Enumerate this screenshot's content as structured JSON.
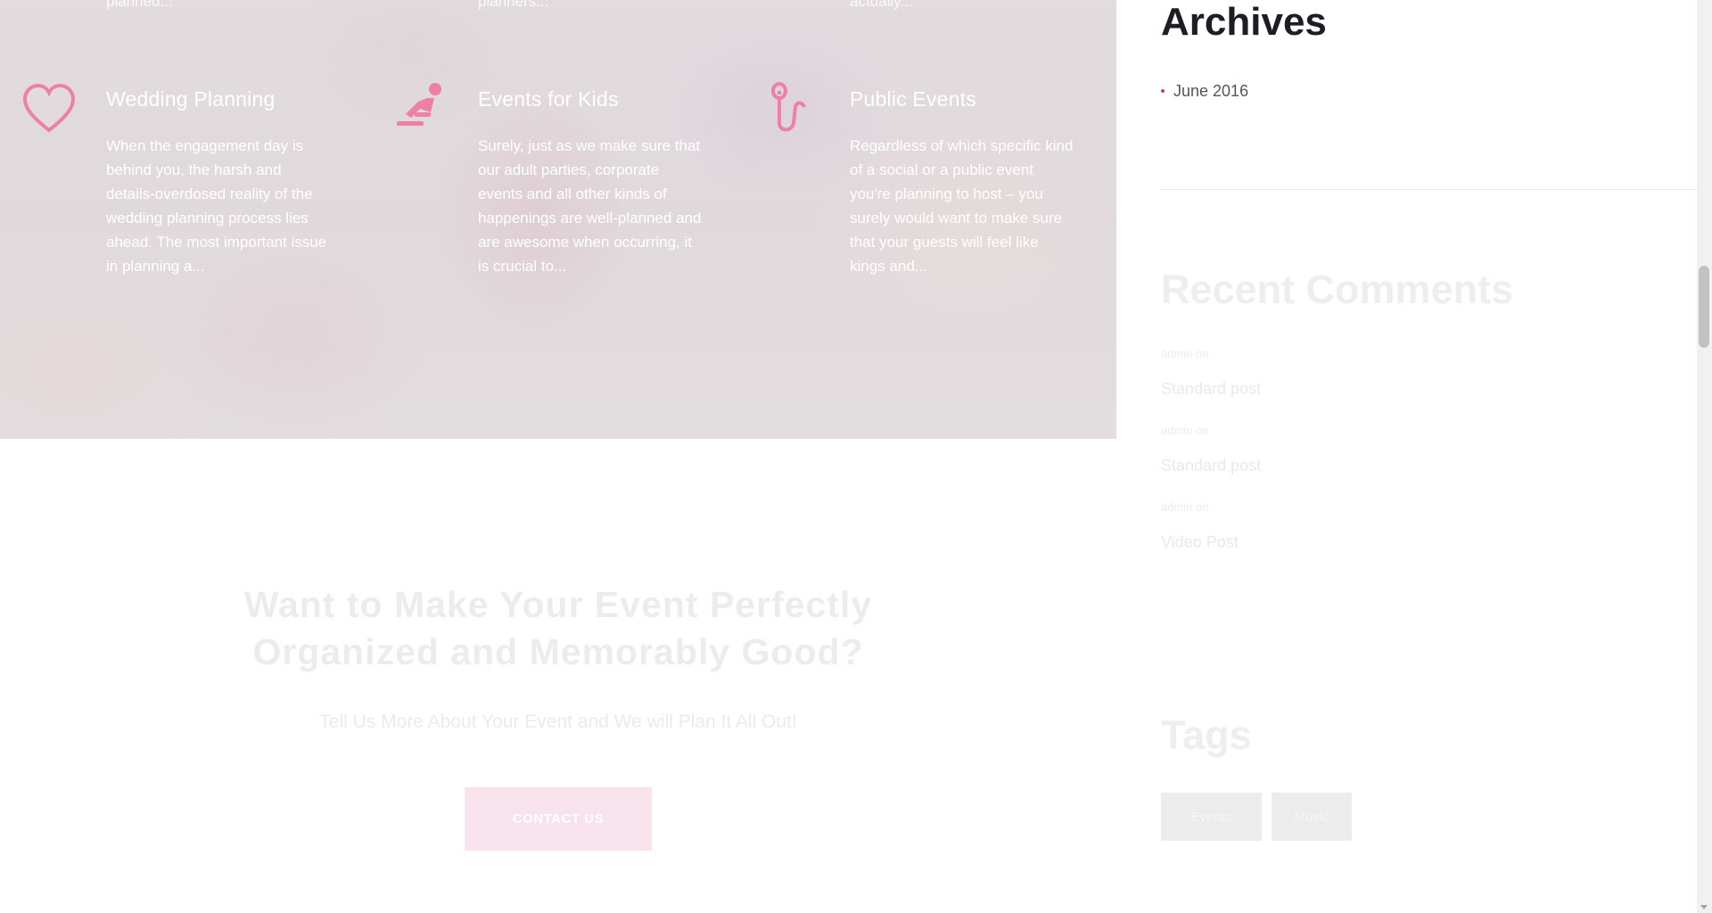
{
  "services": {
    "top_snippets": [
      "planned...",
      "planners...",
      "actually..."
    ],
    "items": [
      {
        "icon": "heart-icon",
        "title": "Wedding Planning",
        "text": "When the engagement day is behind you, the harsh and details-overdosed reality of the wedding planning process lies ahead. The most important issue in planning a..."
      },
      {
        "icon": "kids-icon",
        "title": "Events for Kids",
        "text": "Surely, just as we make sure that our adult parties, corporate events and all other kinds of happenings are well-planned and are awesome when occurring, it is crucial to..."
      },
      {
        "icon": "microphone-icon",
        "title": "Public Events",
        "text": "Regardless of which specific kind of a social or a public event you're planning to host – you surely would want to make sure that your guests will feel like kings and..."
      }
    ],
    "accent_color": "#ee7fa6"
  },
  "cta": {
    "title_line1": "Want to Make Your Event Perfectly",
    "title_line2": "Organized and Memorably Good?",
    "subtitle": "Tell Us More About Your Event and We will Plan It All Out!",
    "button_label": "CONTACT US",
    "button_color": "#f8e2ec"
  },
  "sidebar": {
    "archives": {
      "title": "Archives",
      "items": [
        "June 2016"
      ],
      "bullet_color": "#c23b79"
    },
    "recent_comments": {
      "title": "Recent Comments",
      "items": [
        {
          "meta": "admin on",
          "post": "Standard post"
        },
        {
          "meta": "admin on",
          "post": "Standard post"
        },
        {
          "meta": "admin on",
          "post": "Video Post"
        }
      ]
    },
    "tags": {
      "title": "Tags",
      "items": [
        "Events",
        "Music"
      ]
    }
  }
}
